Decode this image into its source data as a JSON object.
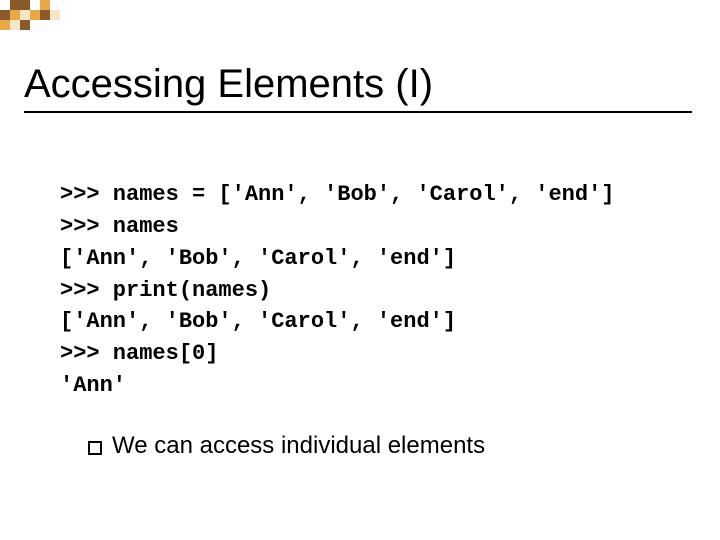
{
  "heading": "Accessing Elements (I)",
  "code": {
    "l1": ">>> names = ['Ann', 'Bob', 'Carol', 'end']",
    "l2": ">>> names",
    "l3": "['Ann', 'Bob', 'Carol', 'end']",
    "l4": ">>> print(names)",
    "l5": "['Ann', 'Bob', 'Carol', 'end']",
    "l6": ">>> names[0]",
    "l7": "'Ann'"
  },
  "bullet": "We can access individual elements"
}
